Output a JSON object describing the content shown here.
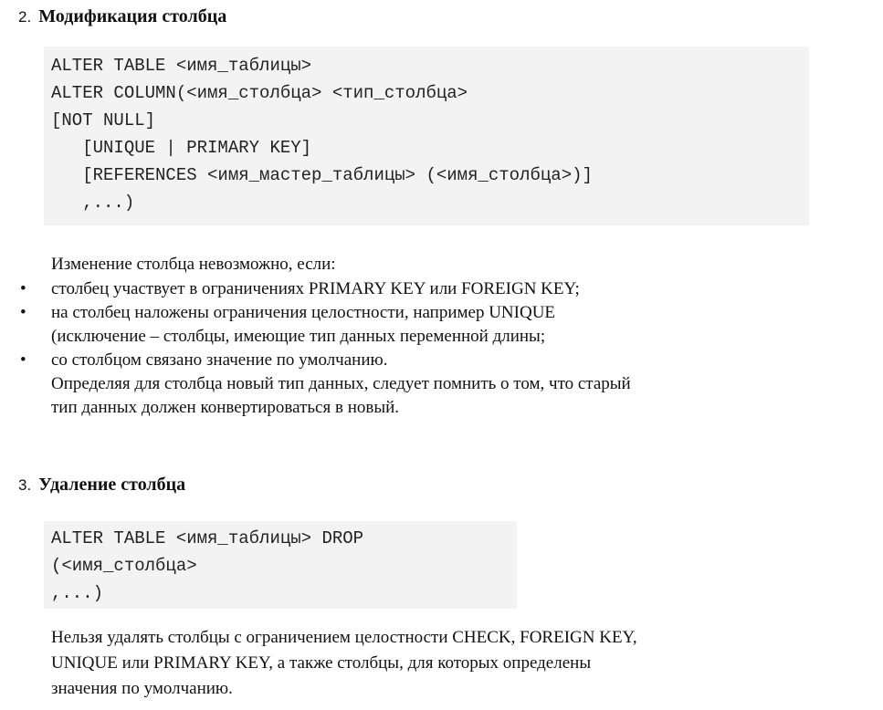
{
  "section2": {
    "number": "2.",
    "title": "Модификация столбца",
    "code_lines": [
      "ALTER TABLE <имя_таблицы>",
      "ALTER COLUMN(<имя_столбца> <тип_столбца>",
      "[NOT NULL]",
      "   [UNIQUE | PRIMARY KEY]",
      "   [REFERENCES <имя_мастер_таблицы> (<имя_столбца>)]",
      "   ,...)"
    ],
    "intro": "Изменение столбца невозможно, если:",
    "bullets": [
      "столбец участвует в ограничениях PRIMARY KEY или FOREIGN KEY;",
      "на столбец наложены ограничения целостности, например UNIQUE",
      "со столбцом связано значение по умолчанию."
    ],
    "bullet2_continuation": "(исключение – столбцы, имеющие тип данных переменной длины;",
    "note_lines": [
      "Определяя для столбца новый тип данных, следует помнить о том, что старый",
      "тип данных должен конвертироваться в новый."
    ],
    "bullet_symbol": "•"
  },
  "section3": {
    "number": "3.",
    "title": "Удаление столбца",
    "code_lines": [
      "ALTER TABLE <имя_таблицы> DROP",
      "(<имя_столбца>",
      ",...)"
    ],
    "text_lines": [
      "Нельзя удалять столбцы с ограничением целостности CHECK, FOREIGN KEY,",
      "UNIQUE или PRIMARY KEY, а также столбцы, для которых определены",
      "значения по умолчанию."
    ]
  }
}
